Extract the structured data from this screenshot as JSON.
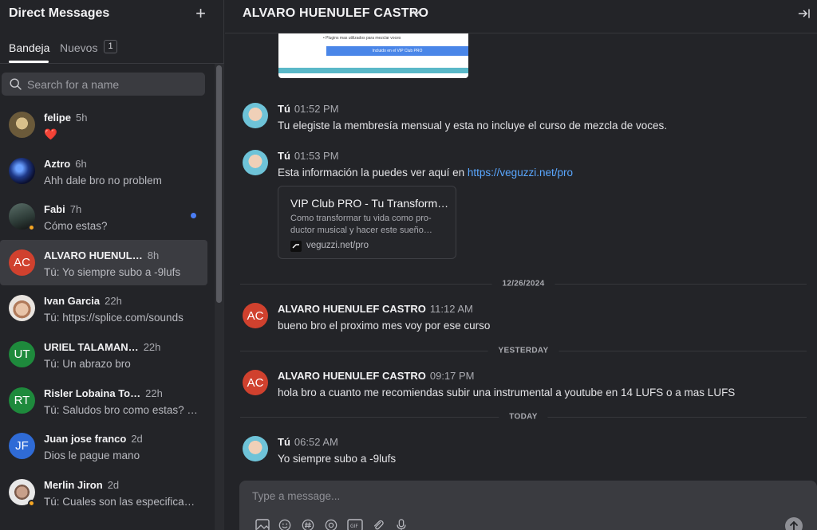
{
  "sidebar": {
    "title": "Direct Messages",
    "tabs": [
      {
        "label": "Bandeja"
      },
      {
        "label": "Nuevos",
        "badge": "1"
      }
    ],
    "search_placeholder": "Search for a name",
    "conversations": [
      {
        "name": "felipe",
        "time": "5h",
        "preview": "❤️",
        "avatar": {
          "type": "photo",
          "color": "#6b5a3a"
        }
      },
      {
        "name": "Aztro",
        "time": "6h",
        "preview": "Ahh dale bro no problem",
        "avatar": {
          "type": "photo",
          "color": "#1f3a8a"
        }
      },
      {
        "name": "Fabi",
        "time": "7h",
        "preview": "Cómo estas?",
        "avatar": {
          "type": "photo",
          "color": "#2c3a36"
        },
        "status": "away",
        "unread": true
      },
      {
        "name": "ALVARO HUENUL…",
        "time": "8h",
        "preview": "Tú: Yo siempre subo a -9lufs",
        "avatar": {
          "type": "initials",
          "initials": "AC",
          "color": "#d0412e"
        },
        "selected": true
      },
      {
        "name": "Ivan Garcia",
        "time": "22h",
        "preview": "Tú: https://splice.com/sounds",
        "avatar": {
          "type": "photo",
          "color": "#c9a58a"
        }
      },
      {
        "name": "URIEL TALAMAN…",
        "time": "22h",
        "preview": "Tú: Un abrazo bro",
        "avatar": {
          "type": "initials",
          "initials": "UT",
          "color": "#1e8a3c"
        }
      },
      {
        "name": "Risler Lobaina To…",
        "time": "22h",
        "preview": "Tú: Saludos bro como estas? …",
        "avatar": {
          "type": "initials",
          "initials": "RT",
          "color": "#1e8a3c"
        }
      },
      {
        "name": "Juan jose franco",
        "time": "2d",
        "preview": "Dios le pague mano",
        "avatar": {
          "type": "initials",
          "initials": "JF",
          "color": "#2f6bd6"
        }
      },
      {
        "name": "Merlin Jiron",
        "time": "2d",
        "preview": "Tú: Cuales son las especifica…",
        "avatar": {
          "type": "photo",
          "color": "#a08070"
        },
        "status": "away"
      }
    ]
  },
  "header": {
    "title": "ALVARO HUENULEF CASTRO"
  },
  "image_preview": {
    "bullet": "• Plugins mas utilizados para mezclar voces",
    "button": "Incluido en el VIP Club PRO"
  },
  "messages": [
    {
      "sender": "Tú",
      "time": "01:52 PM",
      "text": "Tu elegiste la membresía mensual y esta no incluye el curso de mezcla de voces."
    },
    {
      "sender": "Tú",
      "time": "01:53 PM",
      "text_prefix": "Esta información la puedes ver aquí en ",
      "link": "https://veguzzi.net/pro"
    },
    {
      "sender": "ALVARO HUENULEF CASTRO",
      "time": "11:12 AM",
      "text": "bueno bro el proximo mes voy por ese curso"
    },
    {
      "sender": "ALVARO HUENULEF CASTRO",
      "time": "09:17 PM",
      "text": "hola bro a cuanto me recomiendas subir una instrumental a youtube en 14 LUFS o a mas LUFS"
    },
    {
      "sender": "Tú",
      "time": "06:52 AM",
      "text": "Yo siempre subo a -9lufs"
    }
  ],
  "link_card": {
    "title": "VIP Club PRO - Tu Transform…",
    "description": "Como transformar tu vida como pro-ductor musical y hacer este sueño…",
    "domain": "veguzzi.net/pro"
  },
  "dividers": [
    "12/26/2024",
    "YESTERDAY",
    "TODAY"
  ],
  "composer": {
    "placeholder": "Type a message..."
  },
  "colors": {
    "background": "#232428",
    "accent_link": "#5aa7ff",
    "avatar_red": "#d0412e",
    "avatar_green": "#1e8a3c",
    "avatar_blue": "#2f6bd6",
    "unread_dot": "#4a7df5",
    "away_status": "#f5a623"
  }
}
